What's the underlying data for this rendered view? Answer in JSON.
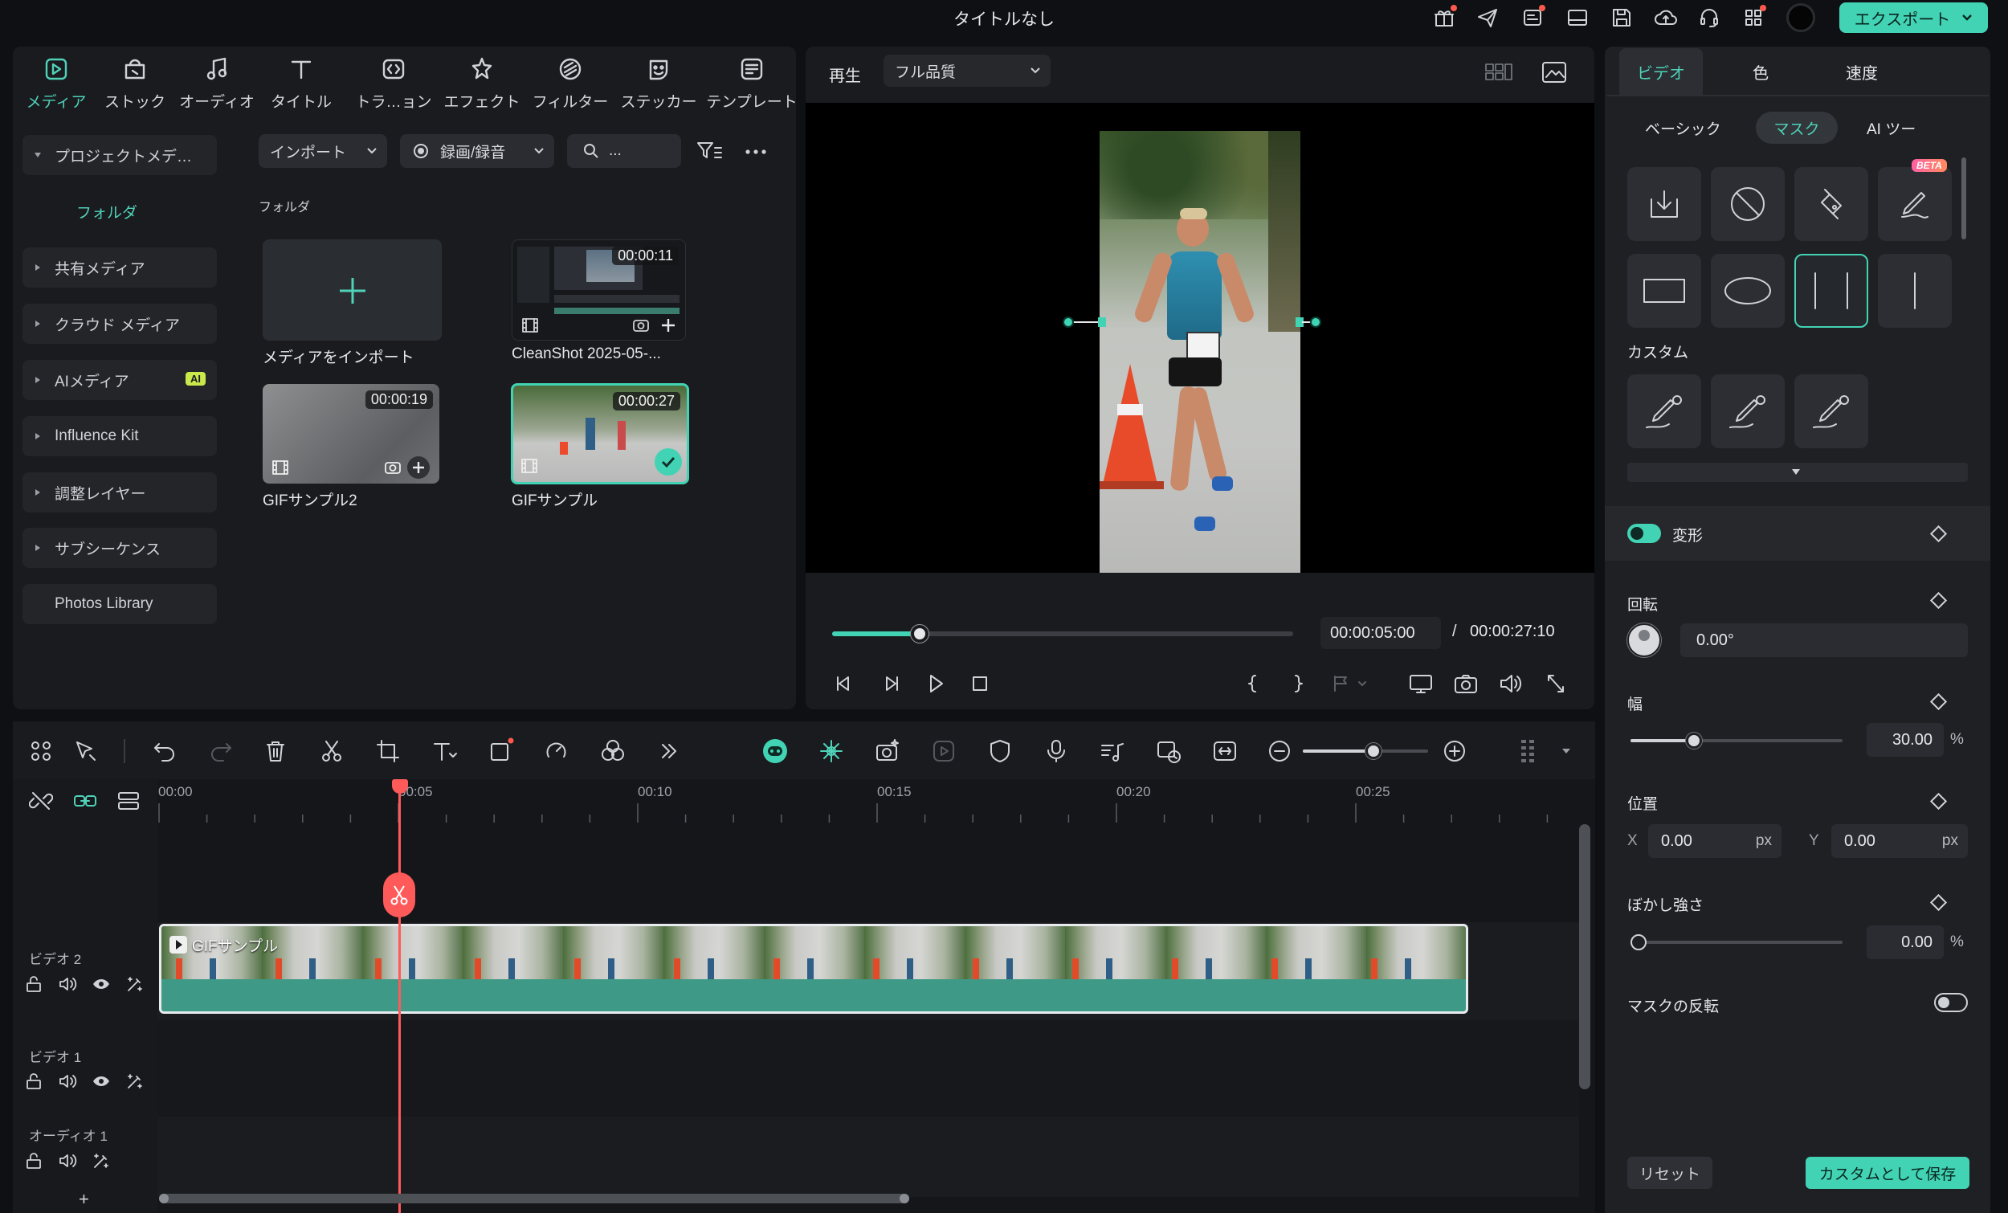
{
  "app": {
    "title": "タイトルなし",
    "export_label": "エクスポート"
  },
  "toolbar": {
    "items": [
      {
        "label": "メディア",
        "icon": "media-icon"
      },
      {
        "label": "ストック",
        "icon": "stock-icon"
      },
      {
        "label": "オーディオ",
        "icon": "audio-icon"
      },
      {
        "label": "タイトル",
        "icon": "title-icon"
      },
      {
        "label": "トラ…ョン",
        "icon": "transition-icon"
      },
      {
        "label": "エフェクト",
        "icon": "effects-icon"
      },
      {
        "label": "フィルター",
        "icon": "filter-icon"
      },
      {
        "label": "ステッカー",
        "icon": "sticker-icon"
      },
      {
        "label": "テンプレート",
        "icon": "template-icon"
      }
    ]
  },
  "media_sidebar": {
    "project_media": "プロジェクトメデ…",
    "folder": "フォルダ",
    "items": [
      "共有メディア",
      "クラウド メディア",
      "AIメディア",
      "Influence Kit",
      "調整レイヤー",
      "サブシーケンス",
      "Photos Library"
    ],
    "ai_badge": "AI"
  },
  "media_toolbar": {
    "import": "インポート",
    "record": "録画/録音",
    "search_placeholder": "..."
  },
  "media_grid": {
    "folder_label": "フォルダ",
    "import_caption": "メディアをインポート",
    "clips": [
      {
        "name": "CleanShot 2025-05-...",
        "duration": "00:00:11"
      },
      {
        "name": "GIFサンプル2",
        "duration": "00:00:19"
      },
      {
        "name": "GIFサンプル",
        "duration": "00:00:27"
      }
    ]
  },
  "player": {
    "play_label": "再生",
    "quality": "フル品質",
    "current_time": "00:00:05:00",
    "separator": "/",
    "total_time": "00:00:27:10",
    "progress": 0.19
  },
  "properties": {
    "tabs": [
      "ビデオ",
      "色",
      "速度"
    ],
    "subtabs": [
      "ベーシック",
      "マスク",
      "AI ツー"
    ],
    "beta": "BETA",
    "custom_label": "カスタム",
    "transform_label": "変形",
    "rotation_label": "回転",
    "rotation_value": "0.00°",
    "width_label": "幅",
    "width_value": "30.00",
    "width_unit": "%",
    "width_fraction": 0.3,
    "position_label": "位置",
    "x_label": "X",
    "x_value": "0.00",
    "y_label": "Y",
    "y_value": "0.00",
    "px_unit": "px",
    "blur_label": "ぼかし強さ",
    "blur_value": "0.00",
    "blur_unit": "%",
    "invert_label": "マスクの反転",
    "reset_label": "リセット",
    "save_custom_label": "カスタムとして保存"
  },
  "timeline": {
    "ruler": [
      "00:00",
      "00:05",
      "00:10",
      "00:15",
      "00:20",
      "00:25"
    ],
    "tracks": [
      "ビデオ 2",
      "ビデオ 1",
      "オーディオ 1"
    ],
    "clip_name": "GIFサンプル",
    "add_track": "+"
  },
  "colors": {
    "accent": "#42d3b4",
    "playhead": "#ff5a5a",
    "clip": "#3e9a86",
    "panel": "#1a1b1f"
  }
}
